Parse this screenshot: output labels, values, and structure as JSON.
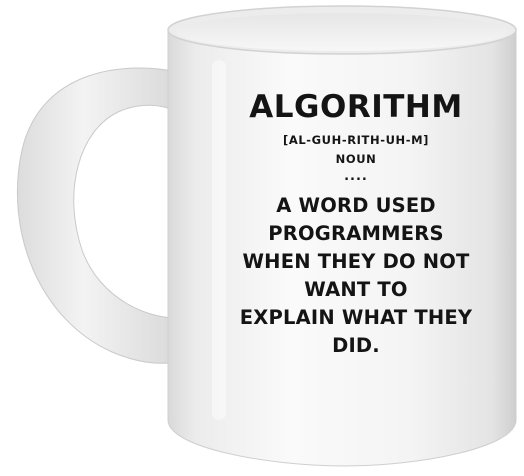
{
  "mug": {
    "print": {
      "title": "ALGORITHM",
      "pronunciation": "[AL-GUH-RITH-UH-M]",
      "part_of_speech": "NOUN",
      "separator": "....",
      "definition_lines": [
        "A WORD USED",
        "PROGRAMMERS",
        "WHEN THEY DO NOT",
        "WANT TO",
        "EXPLAIN WHAT THEY",
        "DID."
      ]
    },
    "colors": {
      "ink": "#141414",
      "mug_body": "#f2f2f2",
      "rim": "#e2e2e2"
    }
  }
}
